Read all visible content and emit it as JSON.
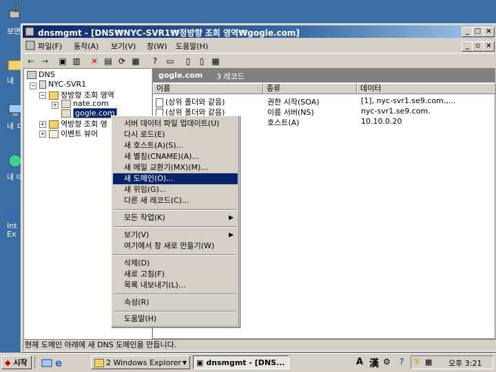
{
  "desktop": {
    "icons": [
      {
        "name": "desktop-icon-1",
        "label": "보면"
      },
      {
        "name": "desktop-icon-2",
        "label": "내"
      },
      {
        "name": "desktop-icon-3",
        "label": "내 ㅁ"
      },
      {
        "name": "desktop-icon-4",
        "label": "내 네"
      },
      {
        "name": "desktop-icon-5",
        "label": "Int Ex"
      }
    ]
  },
  "window": {
    "title": "dnsmgmt - [DNS₩NYC-SVR1₩정방향 조회 영역₩gogle.com]",
    "menu": [
      "파일(F)",
      "동작(A)",
      "보기(V)",
      "창(W)",
      "도움말(H)"
    ]
  },
  "tree": {
    "root": "DNS",
    "server": "NYC-SVR1",
    "forward_zone": "정방향 조회 영역",
    "zones": [
      "nate.com",
      "gogle.com"
    ],
    "reverse_zone": "역방향 조회 영",
    "event_viewer": "이벤트 뷰어"
  },
  "list": {
    "header_name": "gogle.com",
    "header_count": "3 레코드",
    "columns": [
      "이름",
      "종류",
      "데이터"
    ],
    "rows": [
      {
        "name": "(상위 폴더와 같음)",
        "type": "권한 시작(SOA)",
        "data": "[1], nyc-svr1.se9.com.,..."
      },
      {
        "name": "(상위 폴더와 같음)",
        "type": "이름 서버(NS)",
        "data": "nyc-svr1.se9.com."
      },
      {
        "name": "",
        "type": "호스트(A)",
        "data": "10.10.0.20"
      }
    ]
  },
  "context_menu": {
    "items": [
      "서버 데이터 파일 업데이트(U)",
      "다시 로드(E)",
      "새 호스트(A)(S)...",
      "새 별칭(CNAME)(A)...",
      "새 메일 교환기(MX)(M)...",
      "새 도메인(O)...",
      "새 위임(G)...",
      "다른 새 레코드(C)...",
      "모든 작업(K)",
      "보기(V)",
      "여기에서 창 새로 만들기(W)",
      "삭제(D)",
      "새로 고침(F)",
      "목록 내보내기(L)...",
      "속성(R)",
      "도움말(H)"
    ]
  },
  "status": "현재 도메인 아래에 새 DNS 도메인을 만듭니다.",
  "taskbar": {
    "start": "시작",
    "explorer": "2 Windows Explorer",
    "dnsmgmt": "dnsmgmt - [DNS...",
    "ime_a": "A",
    "ime_han": "漢",
    "clock": "오후 3:21"
  }
}
